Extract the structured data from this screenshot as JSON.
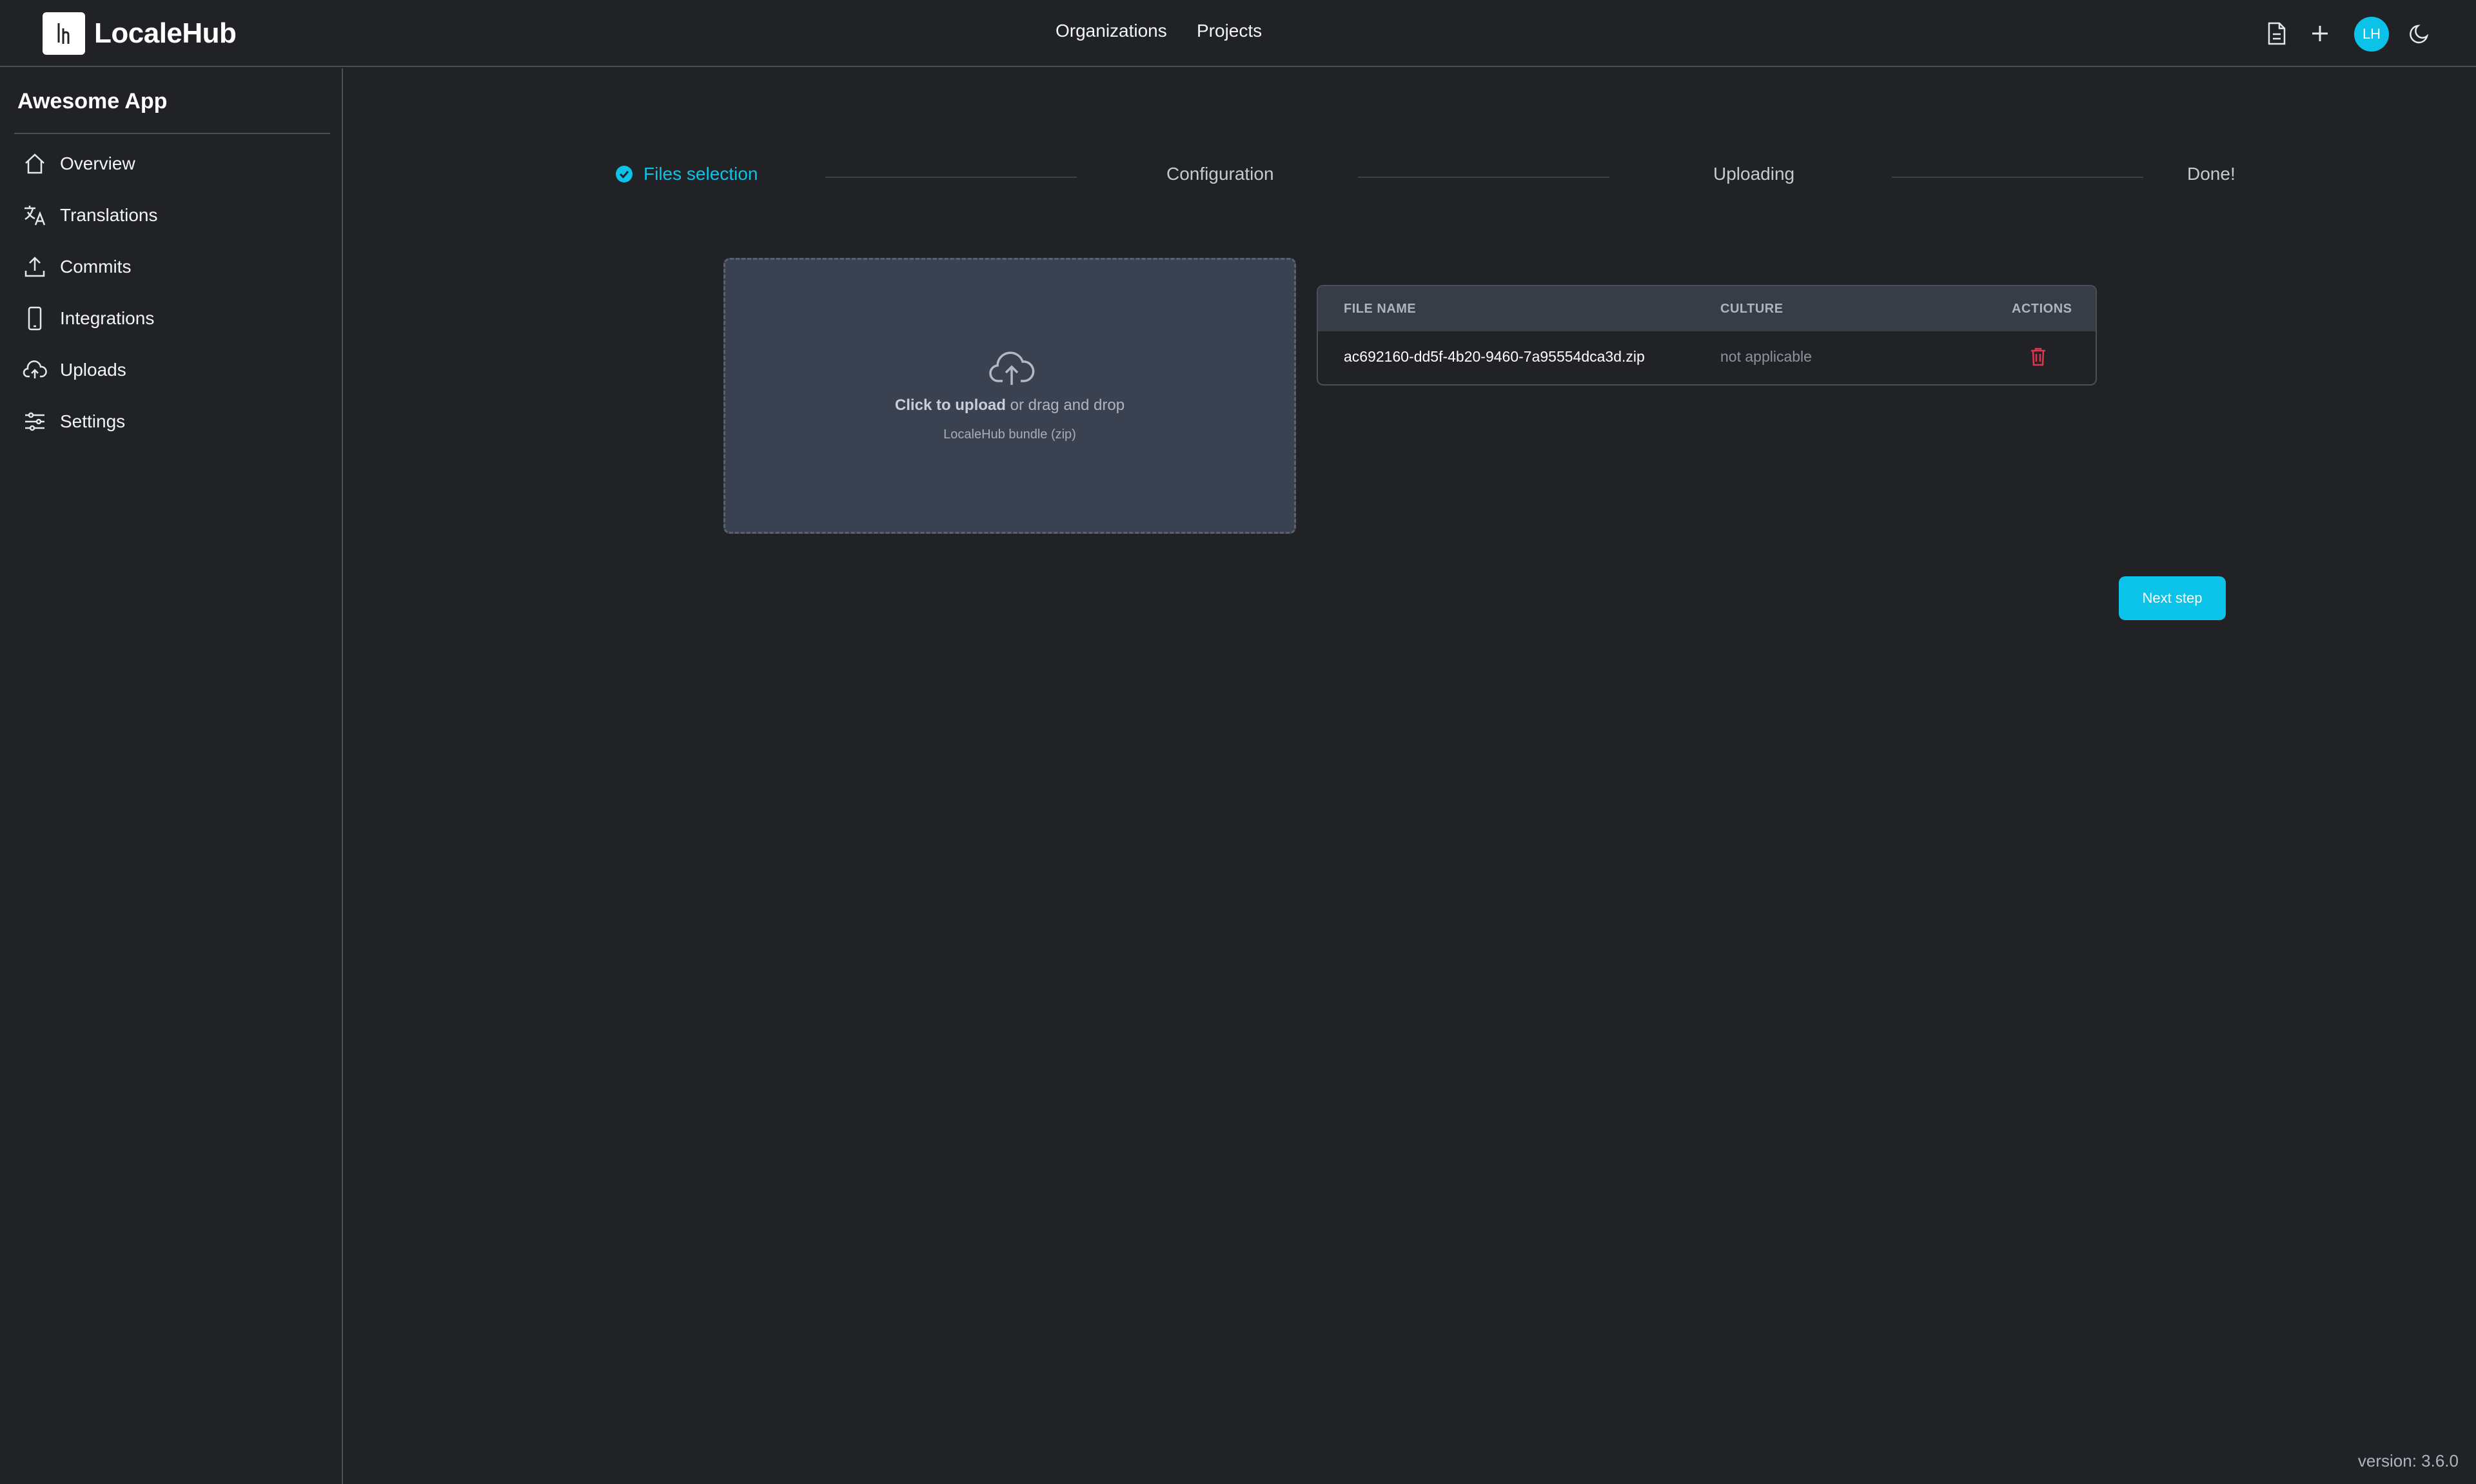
{
  "header": {
    "brand": "LocaleHub",
    "nav": [
      {
        "label": "Organizations"
      },
      {
        "label": "Projects"
      }
    ],
    "icons": [
      "document-icon",
      "plus-icon",
      "moon-icon"
    ],
    "avatar_initials": "LH"
  },
  "sidebar": {
    "project_name": "Awesome App",
    "items": [
      {
        "label": "Overview",
        "icon": "home-icon"
      },
      {
        "label": "Translations",
        "icon": "translate-icon"
      },
      {
        "label": "Commits",
        "icon": "upload-arrow-icon"
      },
      {
        "label": "Integrations",
        "icon": "phone-icon"
      },
      {
        "label": "Uploads",
        "icon": "cloud-upload-icon"
      },
      {
        "label": "Settings",
        "icon": "sliders-icon"
      }
    ]
  },
  "stepper": {
    "steps": [
      {
        "label": "Files selection",
        "state": "active"
      },
      {
        "label": "Configuration",
        "state": "pending"
      },
      {
        "label": "Uploading",
        "state": "pending"
      },
      {
        "label": "Done!",
        "state": "pending"
      }
    ]
  },
  "dropzone": {
    "action": "Click to upload",
    "rest": "or drag and drop",
    "hint": "LocaleHub bundle (zip)"
  },
  "files_table": {
    "headers": {
      "file_name": "FILE NAME",
      "culture": "CULTURE",
      "actions": "ACTIONS"
    },
    "rows": [
      {
        "file_name": "ac692160-dd5f-4b20-9460-7a95554dca3d.zip",
        "culture": "not applicable"
      }
    ]
  },
  "next_button": "Next step",
  "footer": {
    "version": "version: 3.6.0"
  },
  "colors": {
    "accent": "#0bc2e8",
    "danger": "#e0364f",
    "background": "#202226"
  }
}
